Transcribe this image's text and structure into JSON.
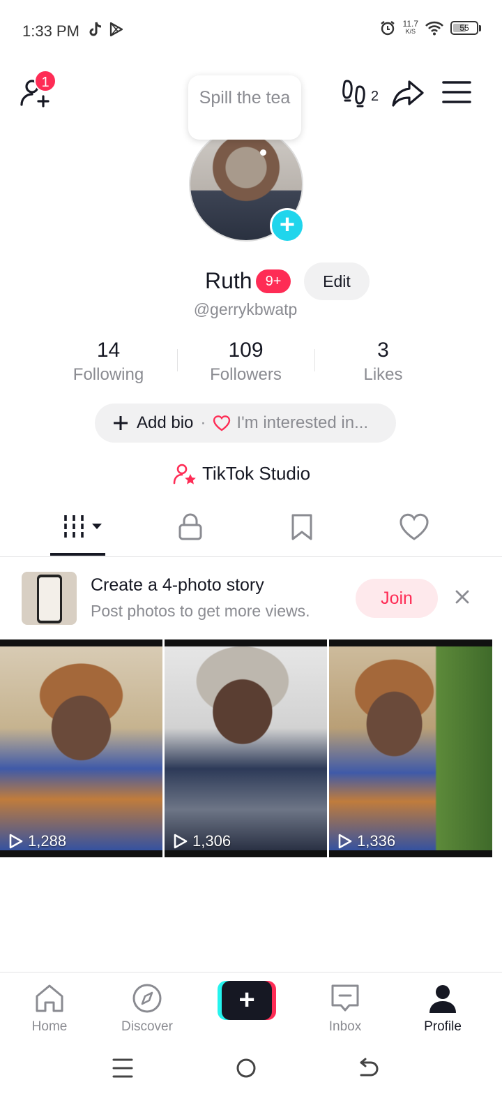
{
  "status_bar": {
    "time": "1:33 PM",
    "net_speed": "11.7",
    "net_unit": "K/S",
    "battery": "55",
    "battery_level": 0.55
  },
  "top_bar": {
    "notification_count": "1",
    "footprints_count": "2"
  },
  "profile": {
    "bubble_text": "Spill the tea",
    "name": "Ruth",
    "name_badge": "9+",
    "edit_label": "Edit",
    "handle": "@gerrykbwatp"
  },
  "stats": [
    {
      "value": "14",
      "label": "Following"
    },
    {
      "value": "109",
      "label": "Followers"
    },
    {
      "value": "3",
      "label": "Likes"
    }
  ],
  "bio": {
    "add_label": "Add bio",
    "separator": "·",
    "interest_label": "I'm interested in..."
  },
  "studio": {
    "label": "TikTok Studio"
  },
  "tabs": [
    "videos-grid",
    "private",
    "saved",
    "liked"
  ],
  "promo": {
    "title": "Create a 4-photo story",
    "subtitle": "Post photos to get more views.",
    "join_label": "Join"
  },
  "videos": [
    {
      "views": "1,288"
    },
    {
      "views": "1,306"
    },
    {
      "views": "1,336"
    }
  ],
  "bottom_nav": {
    "home": "Home",
    "discover": "Discover",
    "inbox": "Inbox",
    "profile": "Profile"
  },
  "colors": {
    "accent": "#fe2c55",
    "cyan": "#20d5ec",
    "text_primary": "#161823",
    "text_secondary": "#8a8b91"
  }
}
